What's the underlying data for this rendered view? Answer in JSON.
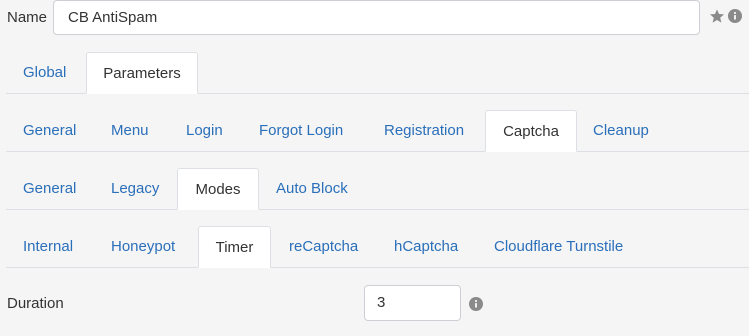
{
  "name_field": {
    "label": "Name",
    "value": "CB AntiSpam"
  },
  "tabs_level1": [
    "Global",
    "Parameters"
  ],
  "tabs_level2": [
    "General",
    "Menu",
    "Login",
    "Forgot Login",
    "Registration",
    "Captcha",
    "Cleanup"
  ],
  "tabs_level3": [
    "General",
    "Legacy",
    "Modes",
    "Auto Block"
  ],
  "tabs_level4": [
    "Internal",
    "Honeypot",
    "Timer",
    "reCaptcha",
    "hCaptcha",
    "Cloudflare Turnstile"
  ],
  "duration": {
    "label": "Duration",
    "value": "3"
  },
  "colors": {
    "link": "#2a6fba",
    "active_text": "#333333",
    "border": "#dcdfe3",
    "background": "#f5f5f5",
    "icon": "#8a8a8a"
  }
}
